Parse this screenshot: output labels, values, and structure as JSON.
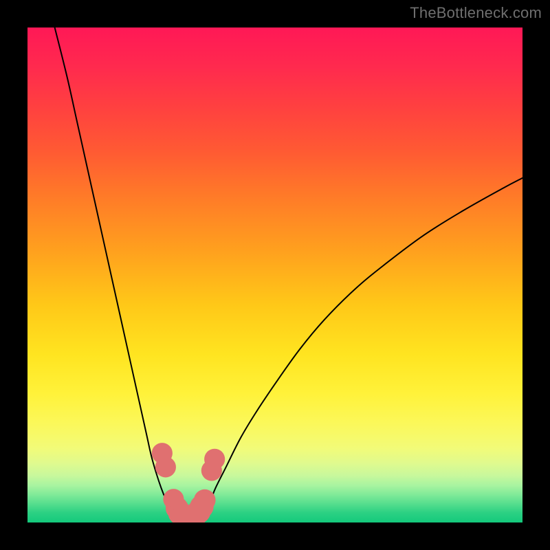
{
  "watermark": "TheBottleneck.com",
  "chart_data": {
    "type": "line",
    "title": "",
    "xlabel": "",
    "ylabel": "",
    "xlim": [
      0,
      100
    ],
    "ylim": [
      0,
      100
    ],
    "grid": false,
    "legend": false,
    "colors": {
      "curve": "#000000",
      "markers": "#e07070",
      "gradient_top": "#ff1856",
      "gradient_mid": "#ffe420",
      "gradient_bottom": "#14c97c"
    },
    "series": [
      {
        "name": "bottleneck-curve-left",
        "x": [
          5.5,
          8,
          10,
          12,
          14,
          16,
          18,
          20,
          22,
          24,
          25,
          26,
          27,
          28,
          29,
          30,
          30.5
        ],
        "y": [
          100,
          90,
          81,
          72,
          63,
          54,
          45,
          36,
          27,
          18,
          13.5,
          10,
          7,
          4.5,
          2.5,
          1,
          0.5
        ]
      },
      {
        "name": "bottleneck-curve-right",
        "x": [
          34.5,
          35,
          36,
          37,
          38,
          40,
          43,
          46,
          50,
          55,
          60,
          66,
          72,
          80,
          88,
          96,
          100
        ],
        "y": [
          0.5,
          1,
          2.5,
          4.5,
          7,
          11,
          17,
          22,
          28,
          35,
          41,
          47,
          52,
          58,
          63,
          67.5,
          69.6
        ]
      }
    ],
    "markers": [
      {
        "x": 27.2,
        "y": 14.0,
        "r": 1.4
      },
      {
        "x": 27.9,
        "y": 11.2,
        "r": 1.4
      },
      {
        "x": 29.5,
        "y": 4.7,
        "r": 1.4
      },
      {
        "x": 30.2,
        "y": 2.9,
        "r": 1.6
      },
      {
        "x": 30.8,
        "y": 1.9,
        "r": 1.7
      },
      {
        "x": 31.5,
        "y": 1.3,
        "r": 1.7
      },
      {
        "x": 32.3,
        "y": 1.1,
        "r": 1.7
      },
      {
        "x": 33.2,
        "y": 1.2,
        "r": 1.7
      },
      {
        "x": 34.0,
        "y": 1.6,
        "r": 1.7
      },
      {
        "x": 34.6,
        "y": 2.2,
        "r": 1.7
      },
      {
        "x": 35.2,
        "y": 3.2,
        "r": 1.7
      },
      {
        "x": 35.8,
        "y": 4.5,
        "r": 1.5
      },
      {
        "x": 37.2,
        "y": 10.5,
        "r": 1.4
      },
      {
        "x": 37.8,
        "y": 12.8,
        "r": 1.4
      }
    ],
    "notch": {
      "x_center": 32.5,
      "depth": 0
    }
  }
}
